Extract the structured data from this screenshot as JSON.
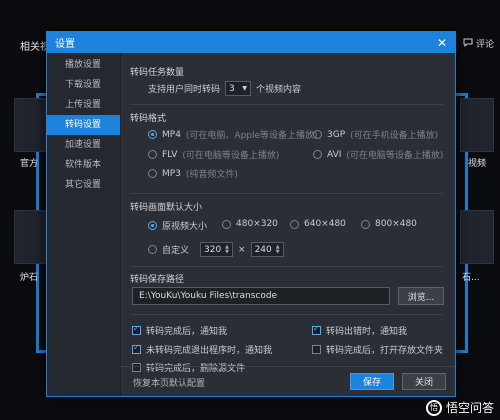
{
  "background": {
    "heading": "相关视",
    "comment": "评论",
    "left_label_1": "官方",
    "left_label_2": "炉石",
    "right_label_1": "视频",
    "right_label_2": "石..."
  },
  "dialog": {
    "title": "设置",
    "close_icon": "close-icon"
  },
  "sidebar": {
    "items": [
      {
        "label": "播放设置",
        "active": false
      },
      {
        "label": "下载设置",
        "active": false
      },
      {
        "label": "上传设置",
        "active": false
      },
      {
        "label": "转码设置",
        "active": true
      },
      {
        "label": "加速设置",
        "active": false
      },
      {
        "label": "软件版本",
        "active": false
      },
      {
        "label": "其它设置",
        "active": false
      }
    ]
  },
  "tasks": {
    "title": "转码任务数量",
    "prefix": "支持用户同时转码",
    "count": "3",
    "suffix": "个视频内容"
  },
  "format": {
    "title": "转码格式",
    "options": [
      {
        "name": "MP4",
        "hint": "(可在电脑、Apple等设备上播放)",
        "selected": true
      },
      {
        "name": "3GP",
        "hint": "(可在手机设备上播放)",
        "selected": false
      },
      {
        "name": "FLV",
        "hint": "(可在电脑等设备上播放)",
        "selected": false
      },
      {
        "name": "AVI",
        "hint": "(可在电脑等设备上播放)",
        "selected": false
      },
      {
        "name": "MP3",
        "hint": "(纯音频文件)",
        "selected": false
      }
    ]
  },
  "size": {
    "title": "转码画面默认大小",
    "options": [
      {
        "label": "原视频大小",
        "selected": true
      },
      {
        "label": "480×320",
        "selected": false
      },
      {
        "label": "640×480",
        "selected": false
      },
      {
        "label": "800×480",
        "selected": false
      }
    ],
    "custom_label": "自定义",
    "width": "320",
    "times": "×",
    "height": "240"
  },
  "path": {
    "title": "转码保存路径",
    "value": "E:\\YouKu\\Youku Files\\transcode",
    "browse_label": "浏览..."
  },
  "notify": {
    "items": [
      {
        "label": "转码完成后，通知我",
        "checked": true
      },
      {
        "label": "转码出错时，通知我",
        "checked": true
      },
      {
        "label": "未转码完成退出程序时，通知我",
        "checked": true
      },
      {
        "label": "转码完成后，打开存放文件夹",
        "checked": false
      },
      {
        "label": "转码完成后，删除源文件",
        "checked": false
      }
    ]
  },
  "footer": {
    "restore_label": "恢复本页默认配置",
    "save_label": "保存",
    "close_label": "关闭"
  },
  "watermark": {
    "text": "悟空问答"
  },
  "colors": {
    "accent": "#1d82dc",
    "dialog_bg": "#2b2f35",
    "sidebar_bg": "#25292f"
  }
}
